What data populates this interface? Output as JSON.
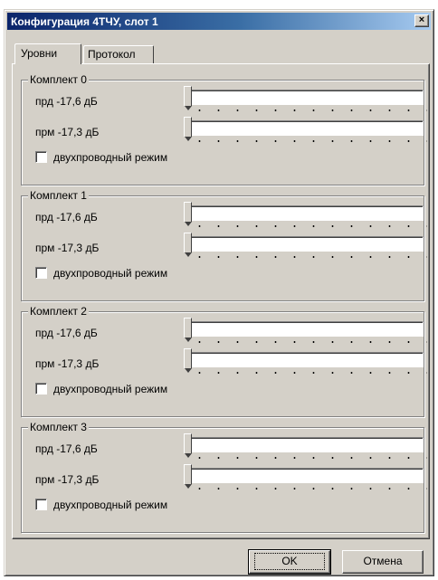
{
  "window": {
    "title": "Конфигурация 4ТЧУ, слот 1",
    "close_label": "×"
  },
  "tabs": [
    {
      "label": "Уровни",
      "active": true
    },
    {
      "label": "Протокол",
      "active": false
    }
  ],
  "groups": [
    {
      "title": "Комплект 0",
      "tx_label": "прд -17,6 дБ",
      "rx_label": "прм -17,3 дБ",
      "tx_level": 0,
      "rx_level": 0,
      "checkbox_label": "двухпроводный режим",
      "checked": false
    },
    {
      "title": "Комплект 1",
      "tx_label": "прд -17,6 дБ",
      "rx_label": "прм -17,3 дБ",
      "tx_level": 0,
      "rx_level": 0,
      "checkbox_label": "двухпроводный режим",
      "checked": false
    },
    {
      "title": "Комплект 2",
      "tx_label": "прд -17,6 дБ",
      "rx_label": "прм -17,3 дБ",
      "tx_level": 0,
      "rx_level": 0,
      "checkbox_label": "двухпроводный режим",
      "checked": false
    },
    {
      "title": "Комплект 3",
      "tx_label": "прд -17,6 дБ",
      "rx_label": "прм -17,3 дБ",
      "tx_level": 0,
      "rx_level": 0,
      "checkbox_label": "двухпроводный режим",
      "checked": false
    }
  ],
  "buttons": {
    "ok": "OK",
    "cancel": "Отмена"
  }
}
